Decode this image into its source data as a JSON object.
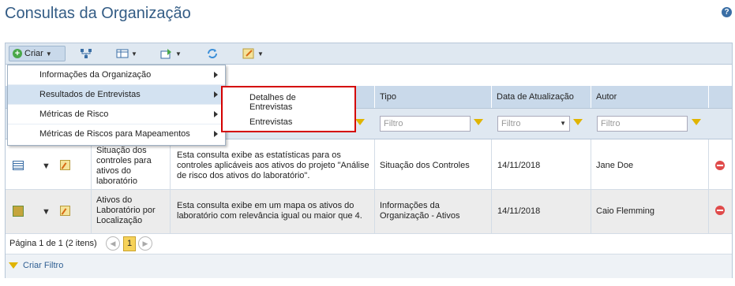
{
  "page": {
    "title": "Consultas da Organização",
    "help_icon": "help-icon"
  },
  "toolbar": {
    "create_label": "Criar",
    "icons": [
      "plus-icon",
      "hierarchy-icon",
      "view-options-icon",
      "export-icon",
      "refresh-icon",
      "edit-icon"
    ]
  },
  "grid": {
    "columns": [
      "Tipo",
      "Data de Atualização",
      "Autor"
    ],
    "filter_placeholder": "Filtro",
    "rows": [
      {
        "name": "Situação dos controles para ativos do laboratório",
        "description": "Esta consulta exibe as estatísticas para os controles aplicáveis aos ativos do projeto \"Análise de risco dos ativos do laboratório\".",
        "type": "Situação dos Controles",
        "updated": "14/11/2018",
        "author": "Jane Doe"
      },
      {
        "name": "Ativos do Laboratório por Localização",
        "description": "Esta consulta exibe em um mapa os ativos do laboratório com relevância igual ou maior que 4.",
        "type": "Informações da Organização - Ativos",
        "updated": "14/11/2018",
        "author": "Caio Flemming"
      }
    ]
  },
  "pager": {
    "text": "Página 1 de 1 (2 itens)",
    "current": "1"
  },
  "footer": {
    "create_filter": "Criar Filtro"
  },
  "menu": {
    "items": [
      "Informações da Organização",
      "Resultados de Entrevistas",
      "Métricas de Risco",
      "Métricas de Riscos para Mapeamentos"
    ],
    "selected_index": 1
  },
  "submenu": {
    "items": [
      "Detalhes de Entrevistas",
      "Entrevistas"
    ]
  },
  "colors": {
    "title": "#335c85",
    "highlight_box": "#d40000",
    "toolbar_bg": "#dfe8f1"
  }
}
